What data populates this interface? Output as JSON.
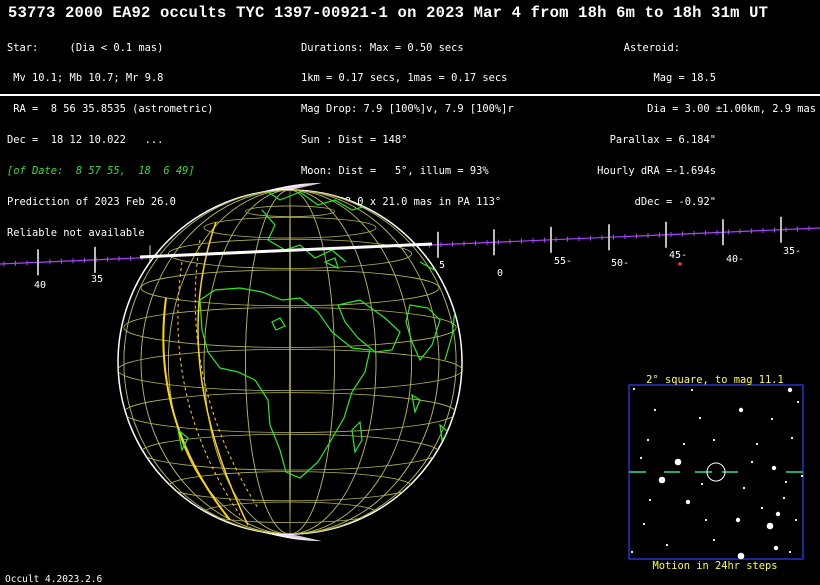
{
  "title": "53773 2000 EA92 occults TYC 1397-00921-1 on 2023 Mar  4 from 18h  6m to 18h 31m UT",
  "star": {
    "heading": "Star:     (Dia < 0.1 mas)",
    "mags": " Mv 10.1; Mb 10.7; Mr 9.8",
    "ra": " RA =  8 56 35.8535 (astrometric)",
    "dec": "Dec =  18 12 10.022   ...",
    "of_date": "[of Date:  8 57 55,  18  6 49]",
    "prediction": "Prediction of 2023 Feb 26.0",
    "reliable": "Reliable not available"
  },
  "event": {
    "durations": "Durations: Max = 0.50 secs",
    "scale": "1km = 0.17 secs, 1mas = 0.17 secs",
    "mag_drop": "Mag Drop: 7.9 [100%]v, 7.9 [100%]r",
    "sun": "Sun : Dist = 148°",
    "moon": "Moon: Dist =   5°, illum = 93%",
    "error": "Error 38.0 x 21.0 mas in PA 113°"
  },
  "asteroid": {
    "heading": "Asteroid:",
    "mag": "Mag = 18.5",
    "dia": "Dia = 3.00 ±1.00km, 2.9 mas",
    "parallax": "Parallax = 6.184\"",
    "hourly_dra": "Hourly dRA =-1.694s",
    "ddec": "dDec = -0.92\""
  },
  "timeline": {
    "labels": [
      "40",
      "35",
      "5",
      "0",
      "55-",
      "50-",
      "45-",
      "40-",
      "35-"
    ]
  },
  "inset": {
    "title": "2° square, to mag 11.1",
    "footer": "Motion in 24hr steps"
  },
  "version": "Occult 4.2023.2.6",
  "colors": {
    "background": "#000000",
    "coastline": "#22ee22",
    "grid": "#c8c85a",
    "path_line": "#ffffff",
    "timeline": "#aa44ff",
    "inset_border": "#2233cc",
    "inset_text": "#ffff33",
    "limb_gold": "#ffd700"
  }
}
